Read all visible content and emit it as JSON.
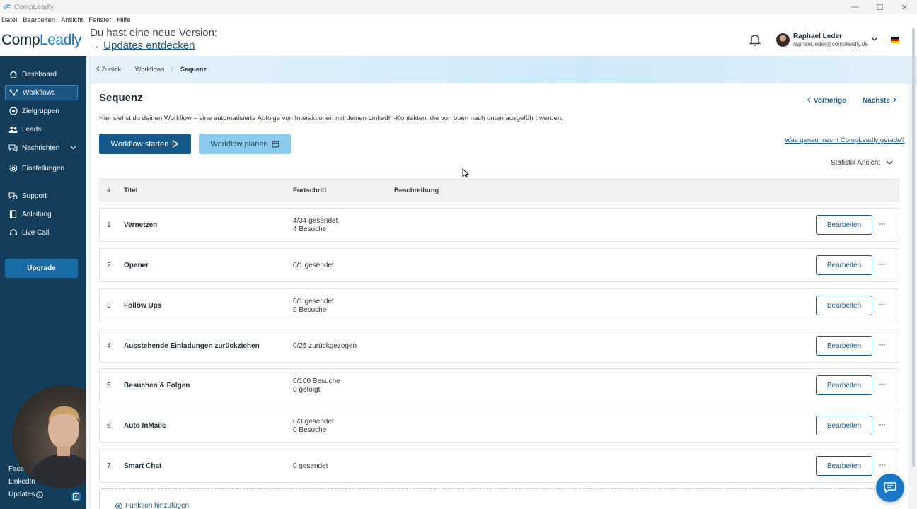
{
  "window": {
    "title": "CompLeadly",
    "controls": [
      "minimize-icon",
      "maximize-icon",
      "close-icon"
    ]
  },
  "menu": [
    "Datei",
    "Bearbeiten",
    "Ansicht",
    "Fenster",
    "Hilfe"
  ],
  "header": {
    "brand_part1": "Comp",
    "brand_part2": "Leadly",
    "update_line1": "Du hast eine neue Version:",
    "update_arrow": "→",
    "update_link": "Updates entdecken",
    "user_name": "Raphael Leder",
    "user_email": "raphael.leder@compleadly.de",
    "flag_colors": [
      "#000000",
      "#dd0000",
      "#ffce00"
    ]
  },
  "sidebar": {
    "items": [
      {
        "label": "Dashboard",
        "icon": "home-icon"
      },
      {
        "label": "Workflows",
        "icon": "workflow-icon",
        "active": true
      },
      {
        "label": "Zielgruppen",
        "icon": "target-icon"
      },
      {
        "label": "Leads",
        "icon": "people-icon"
      },
      {
        "label": "Nachrichten",
        "icon": "chat-icon",
        "has_submenu": true
      },
      {
        "label": "Einstellungen",
        "icon": "gear-icon"
      },
      {
        "label": "Support",
        "icon": "support-icon"
      },
      {
        "label": "Anleitung",
        "icon": "book-icon"
      },
      {
        "label": "Live Call",
        "icon": "headset-icon"
      }
    ],
    "upgrade_label": "Upgrade",
    "bottom_links": [
      "Facebook",
      "LinkedIn",
      "Updates"
    ]
  },
  "breadcrumb": {
    "back": "Zurück",
    "items": [
      "Workflows",
      "Sequenz"
    ]
  },
  "page": {
    "title": "Sequenz",
    "prev": "Vorherige",
    "next": "Nächste",
    "description": "Hier siehst du deinen Workflow – eine automatisierte Abfolge von Interaktionen mit deinen LinkedIn-Kontakten, die von oben nach unten ausgeführt werden.",
    "start_button": "Workflow starten",
    "plan_button": "Workflow planen",
    "help_link": "Was genau macht CompLeadly gerade?",
    "stat_toggle": "Statistik Ansicht",
    "add_function": "Funktion hinzufügen"
  },
  "table": {
    "headers": [
      "#",
      "Titel",
      "Fortschritt",
      "Beschreibung"
    ],
    "edit_label": "Bearbeiten",
    "more_label": "···",
    "rows": [
      {
        "num": "1",
        "title": "Vernetzen",
        "progress": [
          "4/34 gesendet",
          "4 Besuche"
        ]
      },
      {
        "num": "2",
        "title": "Opener",
        "progress": [
          "0/1 gesendet"
        ]
      },
      {
        "num": "3",
        "title": "Follow Ups",
        "progress": [
          "0/1 gesendet",
          "0 Besuche"
        ]
      },
      {
        "num": "4",
        "title": "Ausstehende Einladungen zurückziehen",
        "progress": [
          "0/25 zurückgezogen"
        ]
      },
      {
        "num": "5",
        "title": "Besuchen & Folgen",
        "progress": [
          "0/100 Besuche",
          "0 gefolgt"
        ]
      },
      {
        "num": "6",
        "title": "Auto InMails",
        "progress": [
          "0/3 gesendet",
          "0 Besuche"
        ]
      },
      {
        "num": "7",
        "title": "Smart Chat",
        "progress": [
          "0 gesendet"
        ]
      }
    ]
  },
  "colors": {
    "sidebar_bg": "#133d5a",
    "primary": "#15588a",
    "secondary": "#8ccbee",
    "link": "#1f5a86"
  }
}
